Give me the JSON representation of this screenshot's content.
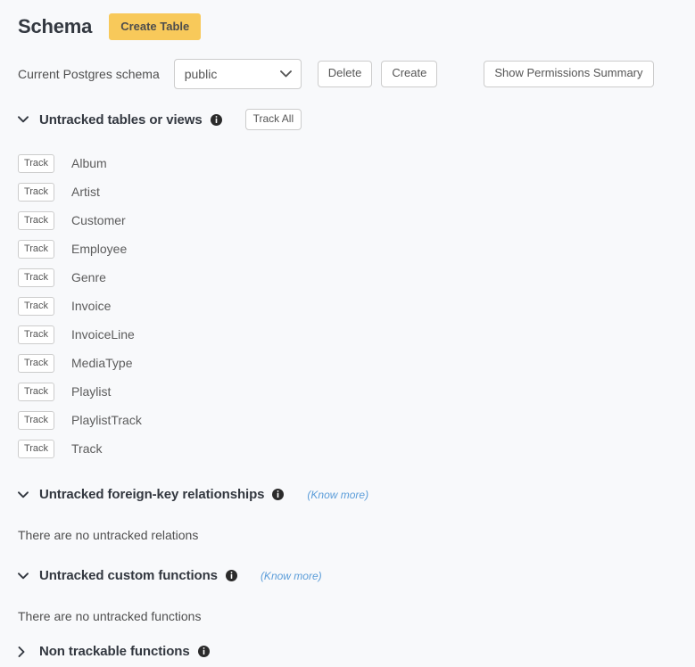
{
  "header": {
    "title": "Schema",
    "create_table_label": "Create Table"
  },
  "schema_selector": {
    "label": "Current Postgres schema",
    "selected_value": "public",
    "options": [
      "public"
    ],
    "delete_label": "Delete",
    "create_label": "Create",
    "permissions_label": "Show Permissions Summary",
    "chevron_icon": "chevron-down-icon"
  },
  "untracked_tables": {
    "title": "Untracked tables or views",
    "chevron_state": "expanded",
    "info_icon": "info-icon",
    "track_all_label": "Track All",
    "track_label": "Track",
    "items": [
      "Album",
      "Artist",
      "Customer",
      "Employee",
      "Genre",
      "Invoice",
      "InvoiceLine",
      "MediaType",
      "Playlist",
      "PlaylistTrack",
      "Track"
    ]
  },
  "untracked_foreign_keys": {
    "title": "Untracked foreign-key relationships",
    "chevron_state": "expanded",
    "info_icon": "info-icon",
    "know_more_label": "(Know more)",
    "empty_message": "There are no untracked relations"
  },
  "untracked_custom_functions": {
    "title": "Untracked custom functions",
    "chevron_state": "expanded",
    "info_icon": "info-icon",
    "know_more_label": "(Know more)",
    "empty_message": "There are no untracked functions"
  },
  "non_trackable_functions": {
    "title": "Non trackable functions",
    "chevron_state": "collapsed",
    "info_icon": "info-icon"
  },
  "colors": {
    "background": "#f8f9fb",
    "accent_yellow": "#f8c95a",
    "heading_text": "#333840",
    "body_text": "#4f4f4f",
    "link_blue": "#5b9dd9",
    "border_gray": "#cccccc"
  }
}
